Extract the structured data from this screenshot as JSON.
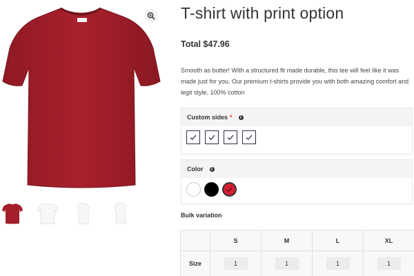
{
  "gallery": {
    "main_image": "red-tshirt",
    "zoom_icon": "zoom-in-icon",
    "thumbnails": [
      {
        "name": "red-tshirt-thumb",
        "color": "#a21f2b"
      },
      {
        "name": "white-tshirt-front-thumb",
        "color": "#f4f4f4"
      },
      {
        "name": "white-tshirt-side-thumb",
        "color": "#f4f4f4"
      },
      {
        "name": "white-tshirt-side-2-thumb",
        "color": "#f4f4f4"
      }
    ]
  },
  "product": {
    "title": "T-shirt with print option",
    "price_label": "Total",
    "price_value": "$47.96",
    "description": "Smooth as butter! With a structured fit made durable, this tee will feel like it was made just for you. Our premium t-shirts provide you with both amazing comfort and legit style. 100% cotton"
  },
  "options": {
    "sides": {
      "label": "Custom sides",
      "required_mark": "*",
      "info_icon": "info-icon",
      "checkboxes": [
        {
          "name": "side-1",
          "checked": true
        },
        {
          "name": "side-2",
          "checked": true
        },
        {
          "name": "side-3",
          "checked": true
        },
        {
          "name": "side-4",
          "checked": true
        }
      ]
    },
    "color": {
      "label": "Color",
      "info_icon": "info-icon",
      "swatches": [
        {
          "name": "white",
          "hex": "#ffffff",
          "selected": false
        },
        {
          "name": "black",
          "hex": "#000000",
          "selected": false
        },
        {
          "name": "red",
          "hex": "#d11f2f",
          "selected": true
        }
      ]
    }
  },
  "bulk": {
    "label": "Bulk variation",
    "columns": [
      "S",
      "M",
      "L",
      "XL"
    ],
    "row_label": "Size",
    "quantities": [
      "1",
      "1",
      "1",
      "1"
    ]
  },
  "colors": {
    "shirt": "#a21f2b",
    "accent_required": "#e2401c"
  }
}
